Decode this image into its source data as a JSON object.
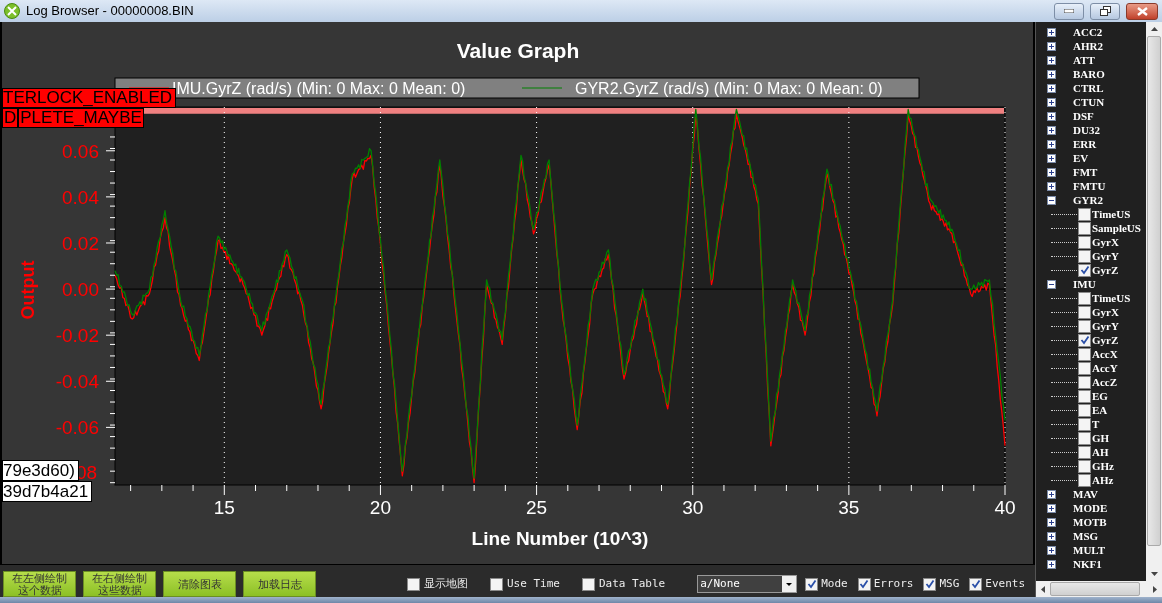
{
  "window": {
    "title": "Log Browser - 00000008.BIN"
  },
  "graph": {
    "chart_data": {
      "type": "line",
      "title": "Value Graph",
      "xlabel": "Line Number (10^3)",
      "ylabel": "Output",
      "x": [
        11.5,
        12.05,
        12.6,
        13.1,
        13.6,
        14.2,
        14.8,
        15.6,
        16.2,
        17.0,
        17.5,
        18.1,
        19.1,
        19.7,
        20.2,
        20.7,
        21.2,
        21.9,
        22.5,
        23.0,
        23.4,
        23.9,
        24.5,
        24.9,
        25.4,
        25.8,
        26.3,
        26.8,
        27.3,
        27.8,
        28.4,
        29.2,
        29.7,
        30.1,
        30.6,
        31.4,
        32.1,
        32.5,
        33.2,
        33.6,
        34.3,
        35.1,
        35.9,
        36.4,
        36.9,
        37.6,
        38.3,
        38.9,
        39.5,
        40.0
      ],
      "series": [
        {
          "name": "IMU.GyrZ (rad/s) (Min: 0 Max: 0 Mean: 0)",
          "color": "#ff0000",
          "values": [
            0.006,
            -0.013,
            -0.002,
            0.031,
            -0.007,
            -0.031,
            0.021,
            0.002,
            -0.02,
            0.015,
            -0.007,
            -0.052,
            0.048,
            0.058,
            -0.007,
            -0.081,
            -0.024,
            0.054,
            -0.02,
            -0.084,
            0.002,
            -0.024,
            0.056,
            0.024,
            0.054,
            -0.007,
            -0.061,
            -0.002,
            0.015,
            -0.039,
            -0.002,
            -0.052,
            0.011,
            0.076,
            0.002,
            0.076,
            0.037,
            -0.068,
            0.002,
            -0.02,
            0.05,
            0.002,
            -0.055,
            -0.007,
            0.076,
            0.037,
            0.024,
            -0.002,
            0.002,
            -0.068
          ]
        },
        {
          "name": "GYR2.GyrZ (rad/s) (Min: 0 Max: 0 Mean: 0)",
          "color": "#008000",
          "values": [
            0.008,
            -0.011,
            0.0,
            0.034,
            -0.005,
            -0.029,
            0.023,
            0.004,
            -0.018,
            0.017,
            -0.005,
            -0.05,
            0.05,
            0.06,
            -0.005,
            -0.079,
            -0.022,
            0.056,
            -0.018,
            -0.082,
            0.004,
            -0.022,
            0.058,
            0.026,
            0.056,
            -0.005,
            -0.059,
            0.0,
            0.017,
            -0.037,
            0.0,
            -0.05,
            0.013,
            0.078,
            0.004,
            0.078,
            0.039,
            -0.066,
            0.004,
            -0.018,
            0.052,
            0.004,
            -0.053,
            -0.005,
            0.078,
            0.039,
            0.026,
            0.0,
            0.004,
            -0.057
          ]
        }
      ],
      "grid": true,
      "legend": true,
      "bands": [
        {
          "axis": "y",
          "from": 0.0765,
          "to": 0.079,
          "color": "#f08080"
        }
      ],
      "xlim": [
        11.5,
        40
      ],
      "ylim": [
        -0.085,
        0.079
      ],
      "xticks": [
        15,
        20,
        25,
        30,
        35,
        40
      ],
      "yticks": [
        {
          "value": 0.06,
          "label": "0.06"
        },
        {
          "value": 0.04,
          "label": "0.04"
        },
        {
          "value": 0.02,
          "label": "0.02"
        },
        {
          "value": 0,
          "label": "0.00"
        },
        {
          "value": -0.02,
          "label": "-0.02"
        },
        {
          "value": -0.04,
          "label": "-0.04"
        },
        {
          "value": -0.06,
          "label": "-0.06"
        }
      ]
    },
    "cut_tick_label": "08",
    "alerts": [
      "TERLOCK_ENABLED"
    ],
    "alerts_row": [
      "D",
      "PLETE_MAYBE"
    ],
    "notes": [
      "79e3d60)",
      "39d7b4a21"
    ]
  },
  "buttons": [
    {
      "lines": [
        "在左侧绘制",
        "这个数据"
      ]
    },
    {
      "lines": [
        "在右侧绘制",
        "这些数据"
      ]
    },
    {
      "lines": [
        "清除图表"
      ]
    },
    {
      "lines": [
        "加载日志"
      ]
    }
  ],
  "options_left": [
    {
      "label": "显示地图",
      "checked": false
    },
    {
      "label": "Use Time",
      "checked": false
    },
    {
      "label": "Data Table",
      "checked": false
    }
  ],
  "dropdown": {
    "value": "a/None"
  },
  "options_right": [
    {
      "label": "Mode",
      "checked": true
    },
    {
      "label": "Errors",
      "checked": true
    },
    {
      "label": "MSG",
      "checked": true
    },
    {
      "label": "Events",
      "checked": true
    }
  ],
  "tree": [
    {
      "label": "ACC2",
      "expanded": false
    },
    {
      "label": "AHR2",
      "expanded": false
    },
    {
      "label": "ATT",
      "expanded": false
    },
    {
      "label": "BARO",
      "expanded": false
    },
    {
      "label": "CTRL",
      "expanded": false
    },
    {
      "label": "CTUN",
      "expanded": false
    },
    {
      "label": "DSF",
      "expanded": false
    },
    {
      "label": "DU32",
      "expanded": false
    },
    {
      "label": "ERR",
      "expanded": false
    },
    {
      "label": "EV",
      "expanded": false
    },
    {
      "label": "FMT",
      "expanded": false
    },
    {
      "label": "FMTU",
      "expanded": false
    },
    {
      "label": "GYR2",
      "expanded": true,
      "children": [
        {
          "label": "TimeUS",
          "checked": false
        },
        {
          "label": "SampleUS",
          "checked": false
        },
        {
          "label": "GyrX",
          "checked": false
        },
        {
          "label": "GyrY",
          "checked": false
        },
        {
          "label": "GyrZ",
          "checked": true
        }
      ]
    },
    {
      "label": "IMU",
      "expanded": true,
      "children": [
        {
          "label": "TimeUS",
          "checked": false
        },
        {
          "label": "GyrX",
          "checked": false
        },
        {
          "label": "GyrY",
          "checked": false
        },
        {
          "label": "GyrZ",
          "checked": true
        },
        {
          "label": "AccX",
          "checked": false
        },
        {
          "label": "AccY",
          "checked": false
        },
        {
          "label": "AccZ",
          "checked": false
        },
        {
          "label": "EG",
          "checked": false
        },
        {
          "label": "EA",
          "checked": false
        },
        {
          "label": "T",
          "checked": false
        },
        {
          "label": "GH",
          "checked": false
        },
        {
          "label": "AH",
          "checked": false
        },
        {
          "label": "GHz",
          "checked": false
        },
        {
          "label": "AHz",
          "checked": false
        }
      ]
    },
    {
      "label": "MAV",
      "expanded": false
    },
    {
      "label": "MODE",
      "expanded": false
    },
    {
      "label": "MOTB",
      "expanded": false
    },
    {
      "label": "MSG",
      "expanded": false
    },
    {
      "label": "MULT",
      "expanded": false
    },
    {
      "label": "NKF1",
      "expanded": false
    }
  ]
}
